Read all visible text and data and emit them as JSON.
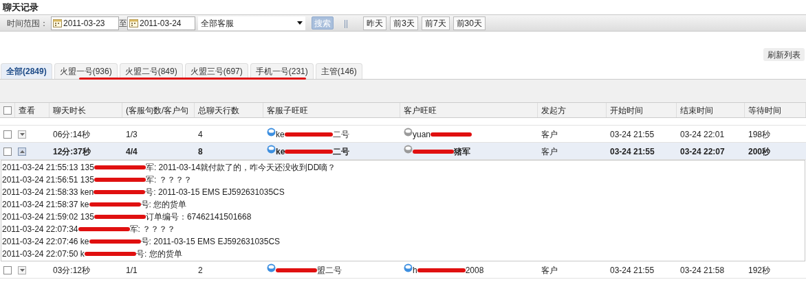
{
  "title": "聊天记录",
  "filter": {
    "label": "时间范围：",
    "start_date": "2011-03-23",
    "separator": "至",
    "end_date": "2011-03-24",
    "agent_select": "全部客服",
    "search_button": "搜索",
    "divider": "||",
    "quick_ranges": [
      "昨天",
      "前3天",
      "前7天",
      "前30天"
    ]
  },
  "refresh_button": "刷新列表",
  "tabs": [
    {
      "label": "全部(2849)",
      "selected": true
    },
    {
      "label": "火盟一号(936)",
      "selected": false
    },
    {
      "label": "火盟二号(849)",
      "selected": false
    },
    {
      "label": "火盟三号(697)",
      "selected": false
    },
    {
      "label": "手机一号(231)",
      "selected": false
    },
    {
      "label": "主管(146)",
      "selected": false
    }
  ],
  "table": {
    "select_all_checked": false,
    "columns": [
      "查看",
      "聊天时长",
      "(客服句数/客户句",
      "总聊天行数",
      "客服子旺旺",
      "客户旺旺",
      "发起方",
      "开始时间",
      "结束时间",
      "等待时间"
    ],
    "rows": [
      {
        "checked": false,
        "expanded": false,
        "duration": "06分:14秒",
        "ratio": "1/3",
        "lines": "4",
        "agent": {
          "online": true,
          "before": "ke",
          "after": "二号"
        },
        "customer": {
          "online": false,
          "before": "yuan"
        },
        "initiator": "客户",
        "start": "03-24 21:55",
        "end": "03-24 22:01",
        "wait": "198秒"
      },
      {
        "checked": false,
        "expanded": true,
        "duration": "12分:37秒",
        "ratio": "4/4",
        "lines": "8",
        "agent": {
          "online": true,
          "before": "ke",
          "after": "二号"
        },
        "customer": {
          "online": false,
          "after": "猪军"
        },
        "initiator": "客户",
        "start": "03-24 21:55",
        "end": "03-24 22:07",
        "wait": "200秒",
        "messages": [
          {
            "before": "2011-03-24 21:55:13 135",
            "after": "军: 2011-03-14就付款了的，咋今天还没收到DD嘀？"
          },
          {
            "before": "2011-03-24 21:56:51 135",
            "after": "军: ？？？？"
          },
          {
            "before": "2011-03-24 21:58:33 ken",
            "after": "号: 2011-03-15 EMS EJ592631035CS"
          },
          {
            "before": "2011-03-24 21:58:37 ke",
            "after": "号: 您的货单"
          },
          {
            "before": "2011-03-24 21:59:02 135",
            "after": "订单编号：67462141501668"
          },
          {
            "before": "2011-03-24 22:07:34",
            "after": "军: ？？？？"
          },
          {
            "before": "2011-03-24 22:07:46 ke",
            "after": "号: 2011-03-15 EMS EJ592631035CS"
          },
          {
            "before": "2011-03-24 22:07:50 k",
            "after": "号: 您的货单"
          }
        ]
      },
      {
        "checked": false,
        "expanded": false,
        "duration": "03分:12秒",
        "ratio": "1/1",
        "lines": "2",
        "agent": {
          "online": true,
          "after": "盟二号"
        },
        "customer": {
          "online": true,
          "before": "h",
          "after": "2008"
        },
        "initiator": "客户",
        "start": "03-24 21:55",
        "end": "03-24 21:58",
        "wait": "192秒"
      }
    ]
  }
}
